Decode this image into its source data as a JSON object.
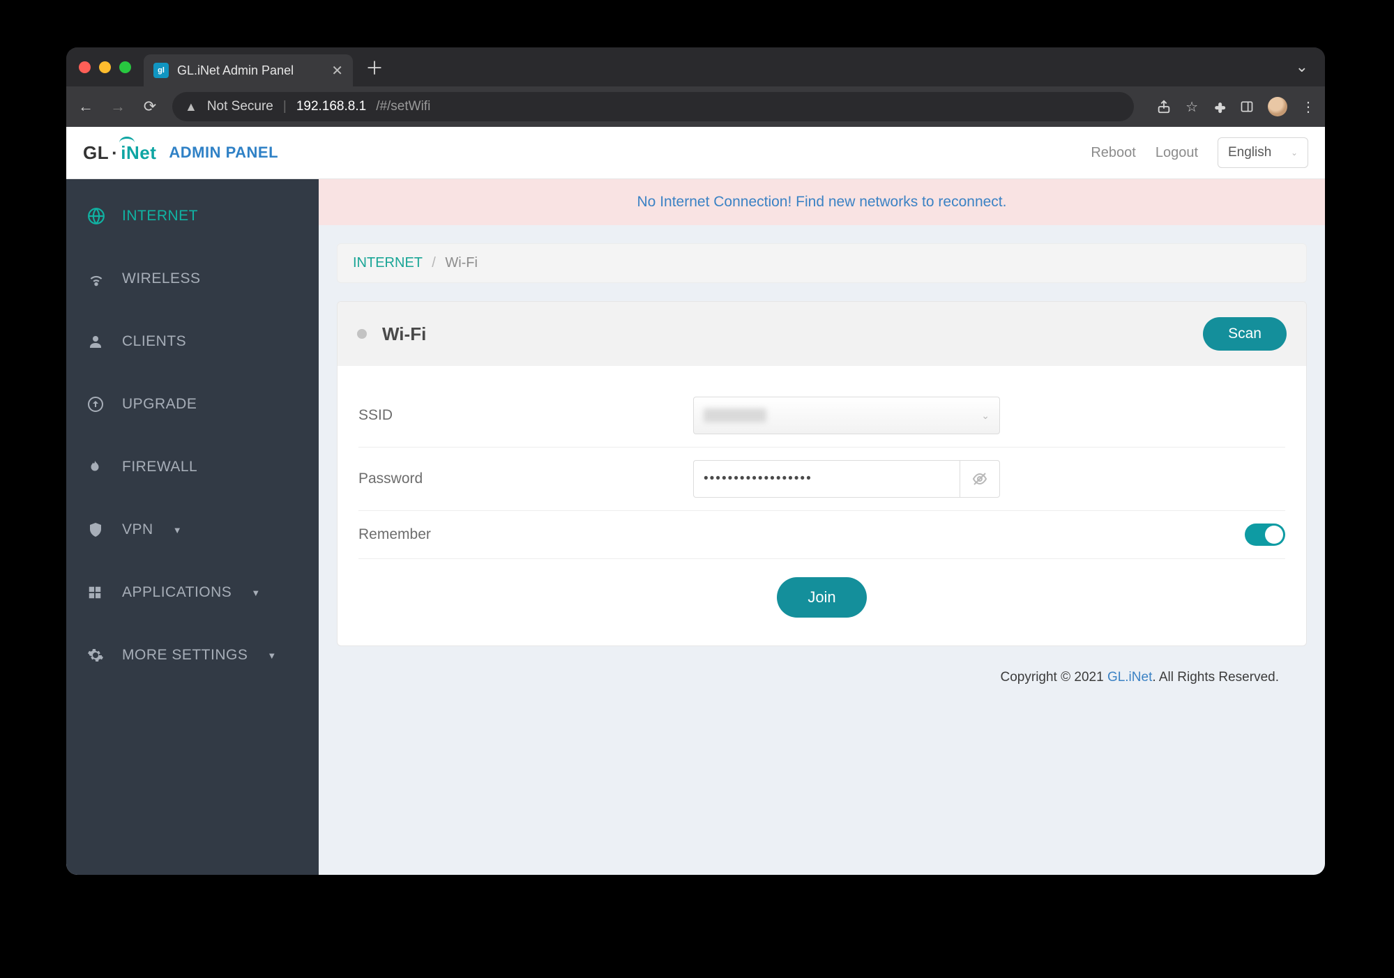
{
  "browser": {
    "tab_title": "GL.iNet Admin Panel",
    "address": {
      "not_secure": "Not Secure",
      "host": "192.168.8.1",
      "path": "/#/setWifi"
    }
  },
  "header": {
    "logo_text_1": "GL",
    "logo_text_2": "iNet",
    "admin_label": "ADMIN PANEL",
    "reboot": "Reboot",
    "logout": "Logout",
    "language": "English"
  },
  "sidebar": {
    "items": [
      {
        "label": "INTERNET"
      },
      {
        "label": "WIRELESS"
      },
      {
        "label": "CLIENTS"
      },
      {
        "label": "UPGRADE"
      },
      {
        "label": "FIREWALL"
      },
      {
        "label": "VPN"
      },
      {
        "label": "APPLICATIONS"
      },
      {
        "label": "MORE SETTINGS"
      }
    ]
  },
  "alert": {
    "text": "No Internet Connection! Find new networks to reconnect."
  },
  "breadcrumb": {
    "root": "INTERNET",
    "current": "Wi-Fi"
  },
  "panel": {
    "title": "Wi-Fi",
    "scan": "Scan",
    "ssid_label": "SSID",
    "ssid_value": "",
    "password_label": "Password",
    "password_value": "••••••••••••••••••",
    "remember_label": "Remember",
    "remember_on": true,
    "join": "Join"
  },
  "footer": {
    "copyright": "Copyright © 2021 ",
    "brand": "GL.iNet",
    "rights": ". All Rights Reserved."
  },
  "colors": {
    "accent": "#148f9b",
    "sidebar_active": "#10b3a3",
    "alert_bg": "#f9e3e3"
  }
}
